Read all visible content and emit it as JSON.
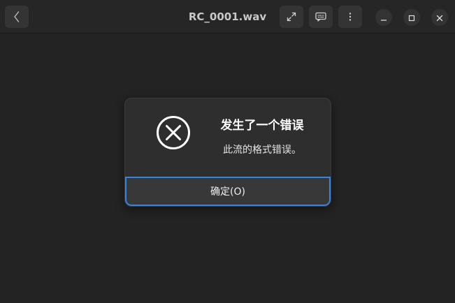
{
  "window": {
    "title": "RC_0001.wav"
  },
  "headerbar": {
    "back_icon": "chevron-left-icon",
    "fullscreen_icon": "expand-icon",
    "subtitles_icon": "subtitles-icon",
    "menu_icon": "vertical-dots-icon",
    "minimize_icon": "minimize-icon",
    "maximize_icon": "maximize-icon",
    "close_icon": "close-icon"
  },
  "dialog": {
    "icon": "error-circle-x-icon",
    "title": "发生了一个错误",
    "message": "此流的格式错误。",
    "ok_label": "确定(O)",
    "accent_color": "#3584e4"
  }
}
